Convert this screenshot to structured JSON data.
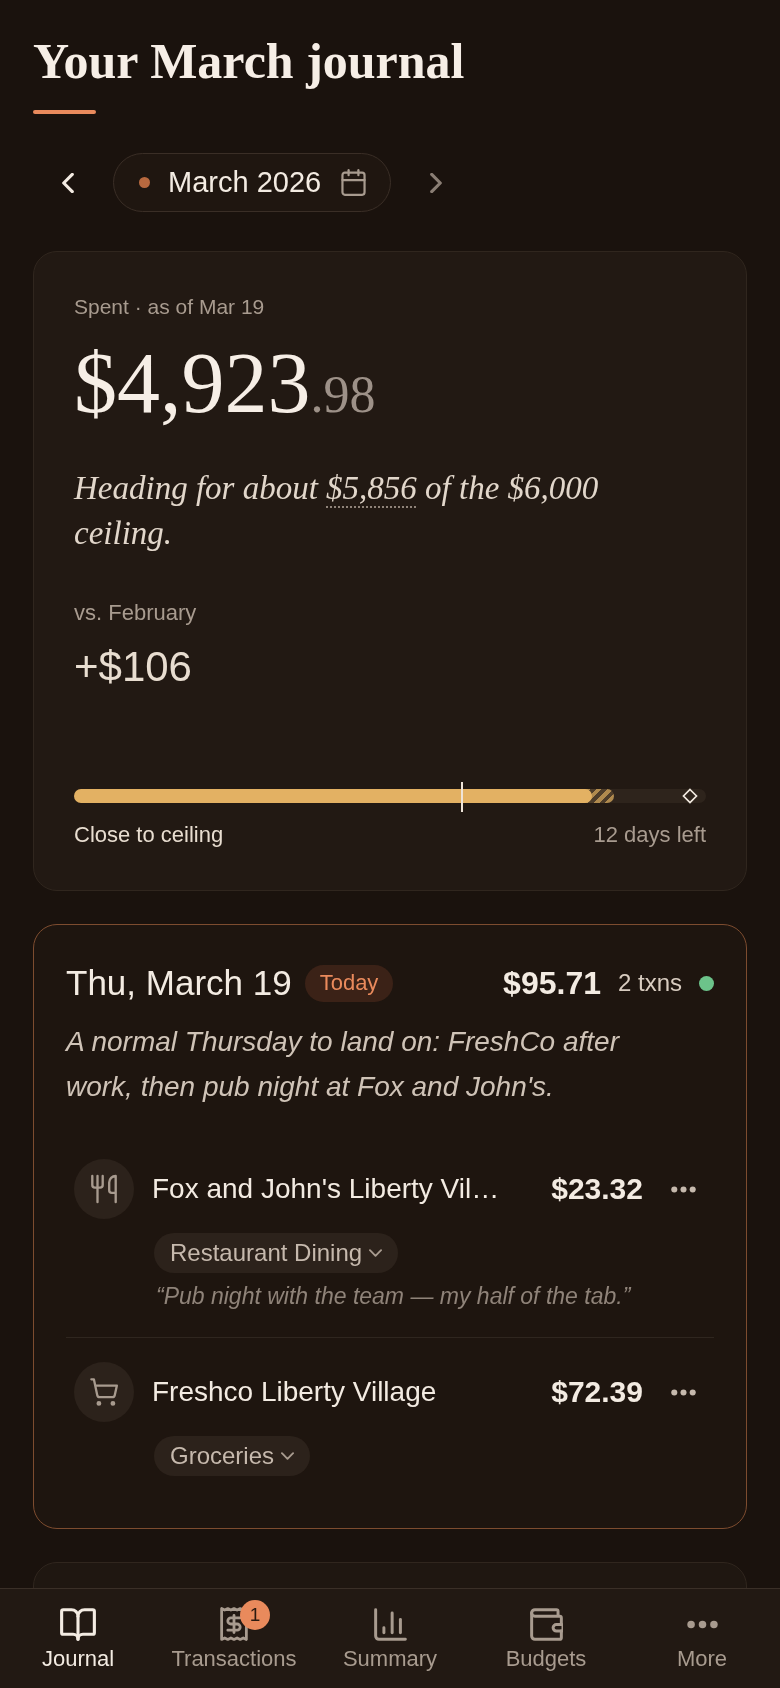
{
  "header": {
    "title": "Your March journal"
  },
  "month_nav": {
    "label": "March 2026",
    "prev": {
      "disabled": false
    },
    "next": {
      "disabled": true
    }
  },
  "summary": {
    "caption": "Spent · as of Mar 19",
    "amount": {
      "whole": "$4,923",
      "cents": ".98"
    },
    "forecast": {
      "before": "Heading for about",
      "figure": "$5,856",
      "after": "of the $6,000 ceiling."
    },
    "comparison": {
      "label": "vs. February",
      "value": "+$106"
    },
    "progress": {
      "level": 0.82,
      "pending": {
        "level": 0.855
      },
      "today_marker": {
        "level": 0.614
      },
      "projection_marker": {
        "level": 0.975
      },
      "status": "Close to ceiling",
      "days_left": "12 days left"
    }
  },
  "days": [
    {
      "date": "Thu, March 19",
      "badge": "Today",
      "highlighted": true,
      "total": "$95.71",
      "count": "2 txns",
      "color": "#6cc38a",
      "summary": "A normal Thursday to land on: FreshCo after work, then pub night at Fox and John's.",
      "transactions": [
        {
          "kind": "dining",
          "merchant": "Fox and John's Liberty Vil…",
          "amount": "$23.32",
          "category": "Restaurant Dining",
          "note": "“Pub night with the team — my half of the tab.”"
        },
        {
          "kind": "grocery",
          "merchant": "Freshco Liberty Village",
          "amount": "$72.39",
          "category": "Groceries"
        }
      ]
    }
  ],
  "tab_bar": [
    {
      "label": "Journal",
      "kind": "journal",
      "selected": true
    },
    {
      "label": "Transactions",
      "kind": "transactions",
      "selected": false,
      "badge": "1"
    },
    {
      "label": "Summary",
      "kind": "summary",
      "selected": false
    },
    {
      "label": "Budgets",
      "kind": "budgets",
      "selected": false
    },
    {
      "label": "More",
      "kind": "more",
      "selected": false
    }
  ]
}
